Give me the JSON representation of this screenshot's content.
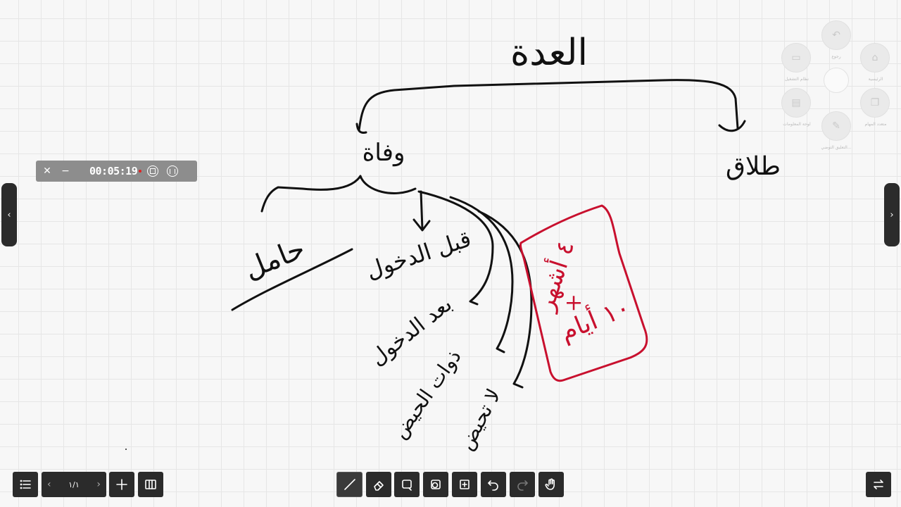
{
  "whiteboard": {
    "title_handwritten": "العدة",
    "branch_death": "وفاة",
    "branch_divorce": "طلاق",
    "node_pregnant": "حامل",
    "node_before_entry": "قبل الدخول",
    "node_after_entry": "بعد الدخول",
    "node_menstruating": "ذوات الحيض",
    "node_non_menstruating": "لا تحيض",
    "red_box_line1": "٤ أشهر",
    "red_box_plus": "+",
    "red_box_line2": "١٠ أيام",
    "ink_color": "#111111",
    "highlight_color": "#c8102e"
  },
  "recorder": {
    "time": "00:05:19",
    "close_icon": "close-icon",
    "minimize_icon": "minimize-icon",
    "stop_icon": "stop-icon",
    "pause_icon": "pause-icon"
  },
  "side_nav": {
    "left_glyph": "‹",
    "right_glyph": "›"
  },
  "floating_menu": {
    "items": [
      {
        "label": "رجوع",
        "icon": "back-icon"
      },
      {
        "label": "الرئيسية",
        "icon": "home-icon"
      },
      {
        "label": "نظام التشغيل",
        "icon": "system-icon"
      },
      {
        "label": "لوحة المعلومات",
        "icon": "dashboard-icon"
      },
      {
        "label": "متعدد المهام",
        "icon": "multitask-icon"
      },
      {
        "label": "التعليق التوضي...",
        "icon": "annotate-icon"
      }
    ]
  },
  "bottom_toolbar": {
    "page_indicator": "١/١",
    "tools": [
      "menu-icon",
      "add-page-icon",
      "page-overview-icon",
      "pen-icon",
      "eraser-icon",
      "lasso-icon",
      "shapes-icon",
      "insert-icon",
      "undo-icon",
      "redo-icon",
      "gesture-icon",
      "switch-icon"
    ]
  }
}
